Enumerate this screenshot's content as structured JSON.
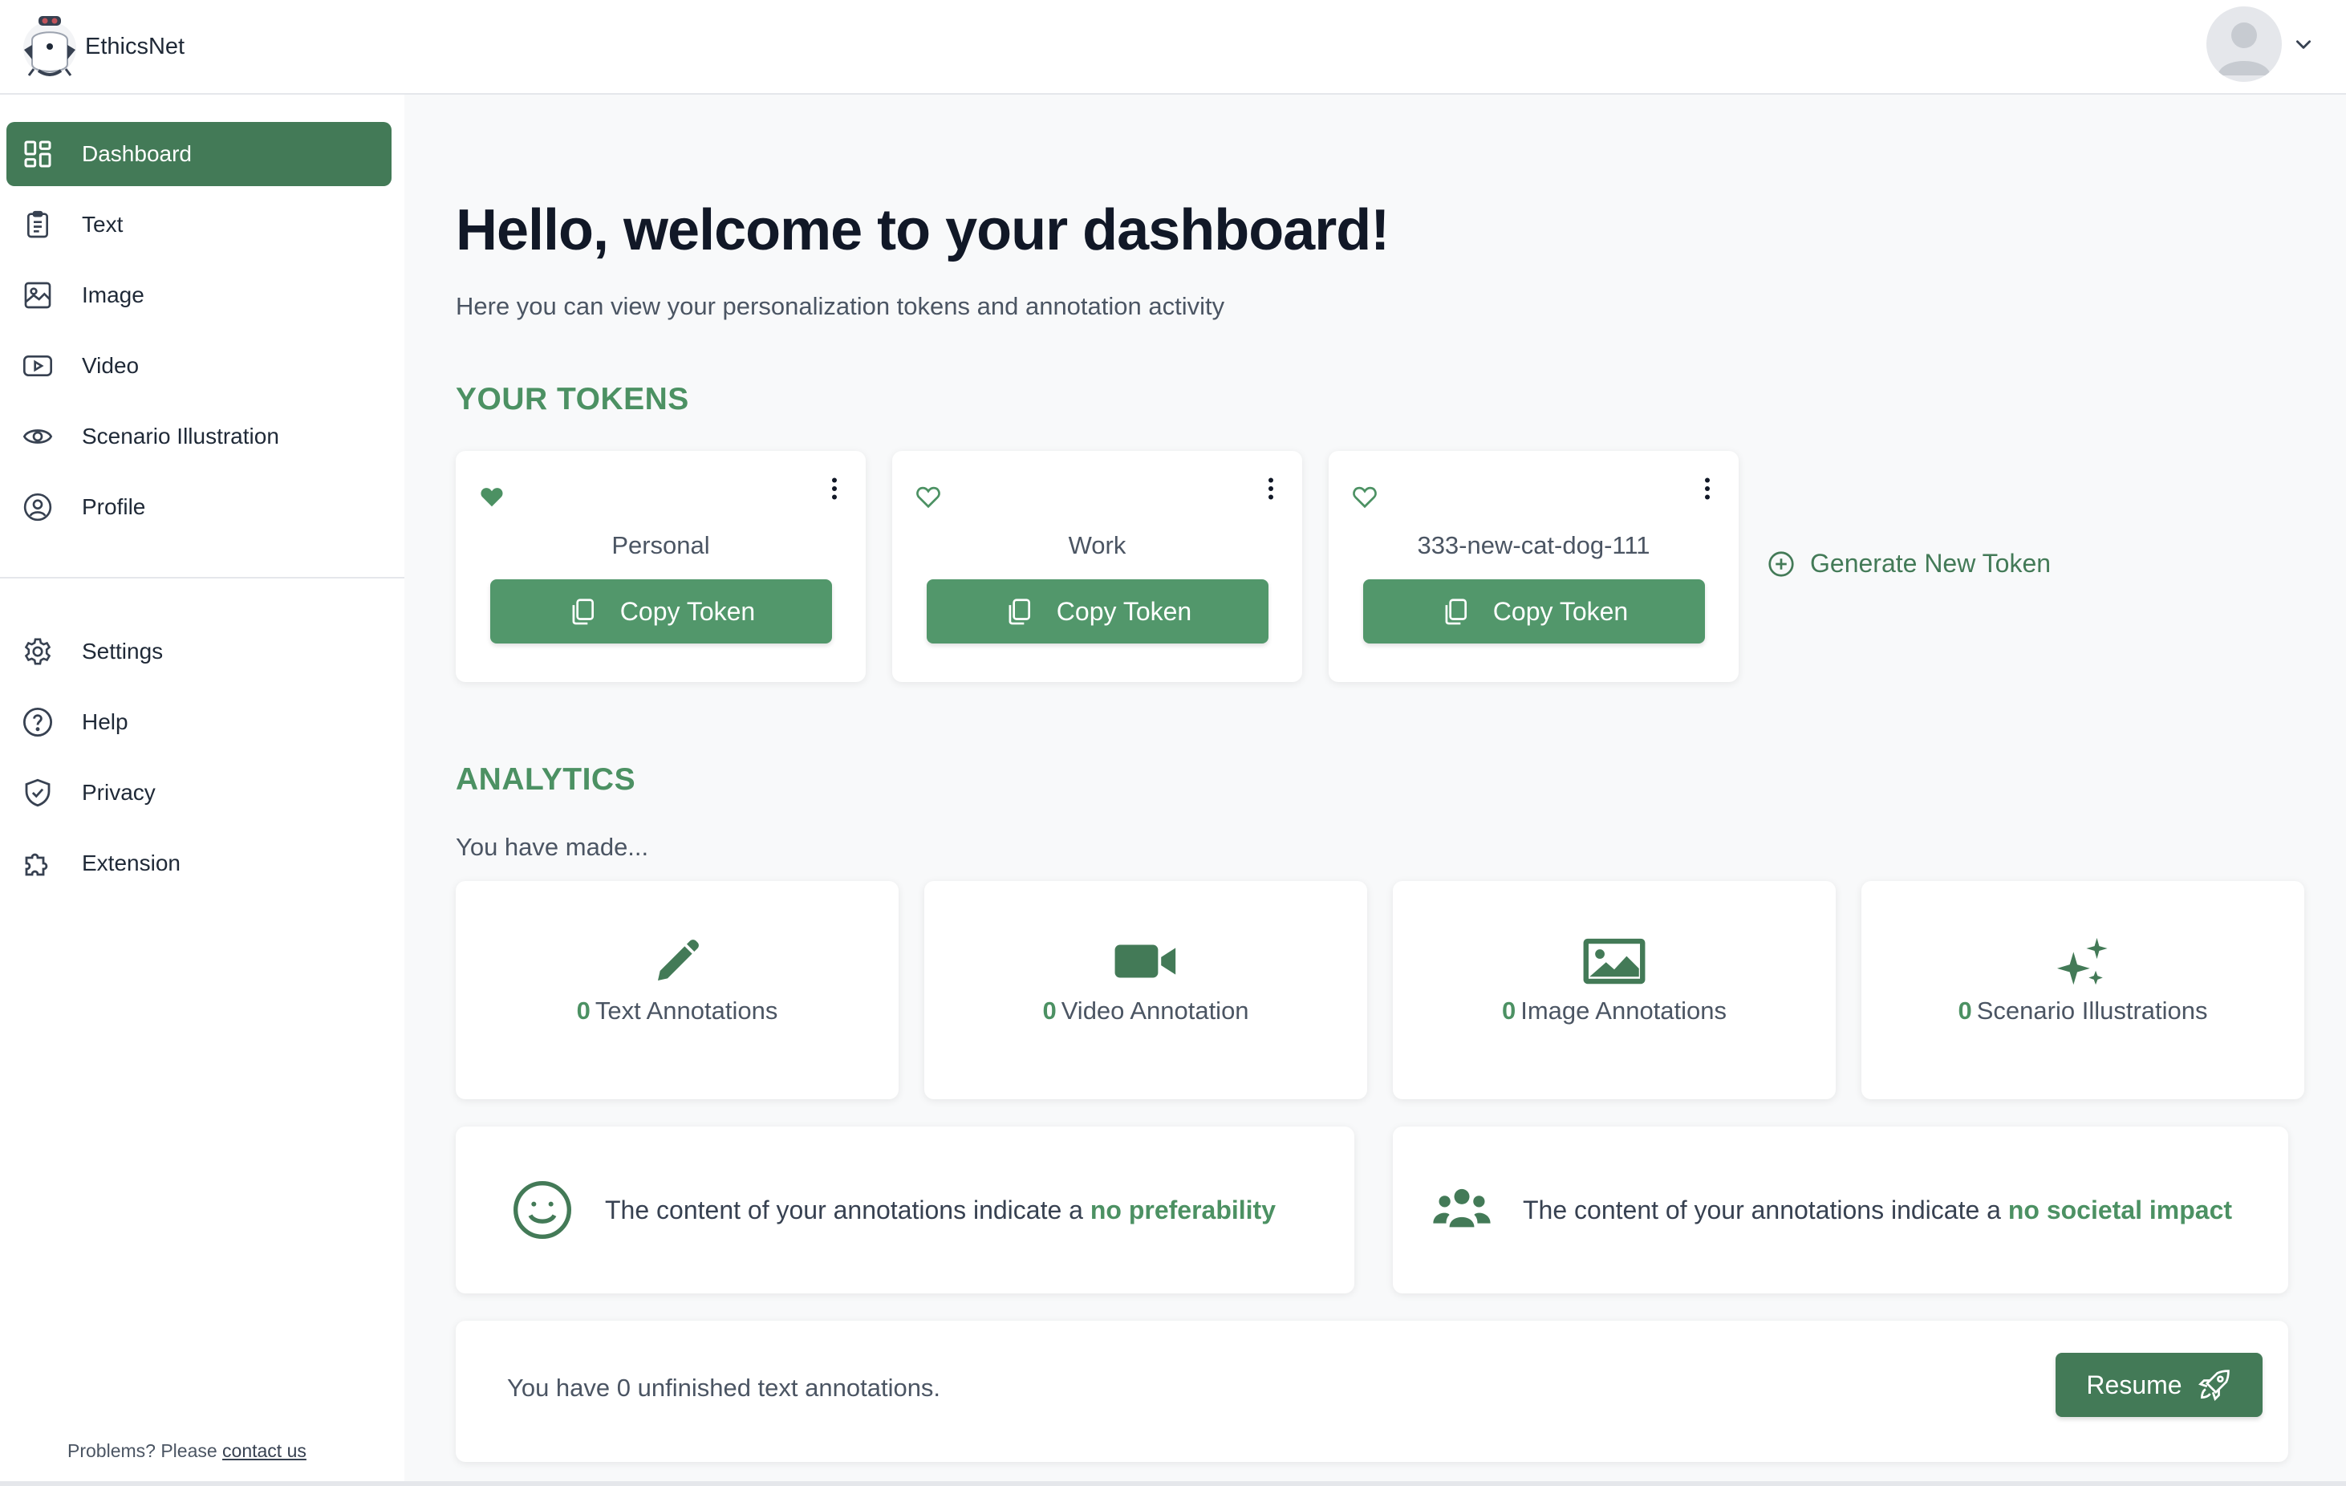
{
  "app": {
    "name": "EthicsNet"
  },
  "sidebar": {
    "main_items": [
      {
        "label": "Dashboard",
        "icon": "dashboard-grid-icon",
        "active": true
      },
      {
        "label": "Text",
        "icon": "clipboard-list-icon"
      },
      {
        "label": "Image",
        "icon": "image-icon"
      },
      {
        "label": "Video",
        "icon": "video-play-icon"
      },
      {
        "label": "Scenario Illustration",
        "icon": "eye-icon"
      },
      {
        "label": "Profile",
        "icon": "user-circle-icon"
      }
    ],
    "secondary_items": [
      {
        "label": "Settings",
        "icon": "gear-icon"
      },
      {
        "label": "Help",
        "icon": "question-circle-icon"
      },
      {
        "label": "Privacy",
        "icon": "shield-check-icon"
      },
      {
        "label": "Extension",
        "icon": "puzzle-icon"
      }
    ],
    "footer": {
      "text": "Problems? Please",
      "link": "contact us"
    }
  },
  "main": {
    "title": "Hello, welcome to your dashboard!",
    "subtitle": "Here you can view your personalization tokens and annotation activity",
    "tokens_heading": "YOUR TOKENS",
    "tokens": [
      {
        "name": "Personal",
        "favorite": true,
        "button": "Copy Token"
      },
      {
        "name": "Work",
        "favorite": false,
        "button": "Copy Token"
      },
      {
        "name": "333-new-cat-dog-111",
        "favorite": false,
        "button": "Copy Token"
      }
    ],
    "generate_token_label": "Generate New Token",
    "analytics_heading": "ANALYTICS",
    "analytics_intro": "You have made...",
    "stats": [
      {
        "count": "0",
        "label": "Text Annotations",
        "icon": "pencil-icon"
      },
      {
        "count": "0",
        "label": "Video Annotation",
        "icon": "video-camera-icon"
      },
      {
        "count": "0",
        "label": "Image Annotations",
        "icon": "photo-icon"
      },
      {
        "count": "0",
        "label": "Scenario Illustrations",
        "icon": "sparkles-icon"
      }
    ],
    "insights": [
      {
        "prefix": "The content of your annotations indicate a",
        "highlight": "no preferability",
        "icon": "smiley-icon"
      },
      {
        "prefix": "The content of your annotations indicate a",
        "highlight": "no societal impact",
        "icon": "users-group-icon"
      }
    ],
    "unfinished": {
      "text": "You have 0 unfinished text annotations.",
      "button": "Resume"
    }
  },
  "colors": {
    "primary": "#437a57",
    "accent": "#4c9163",
    "button": "#52976b"
  }
}
